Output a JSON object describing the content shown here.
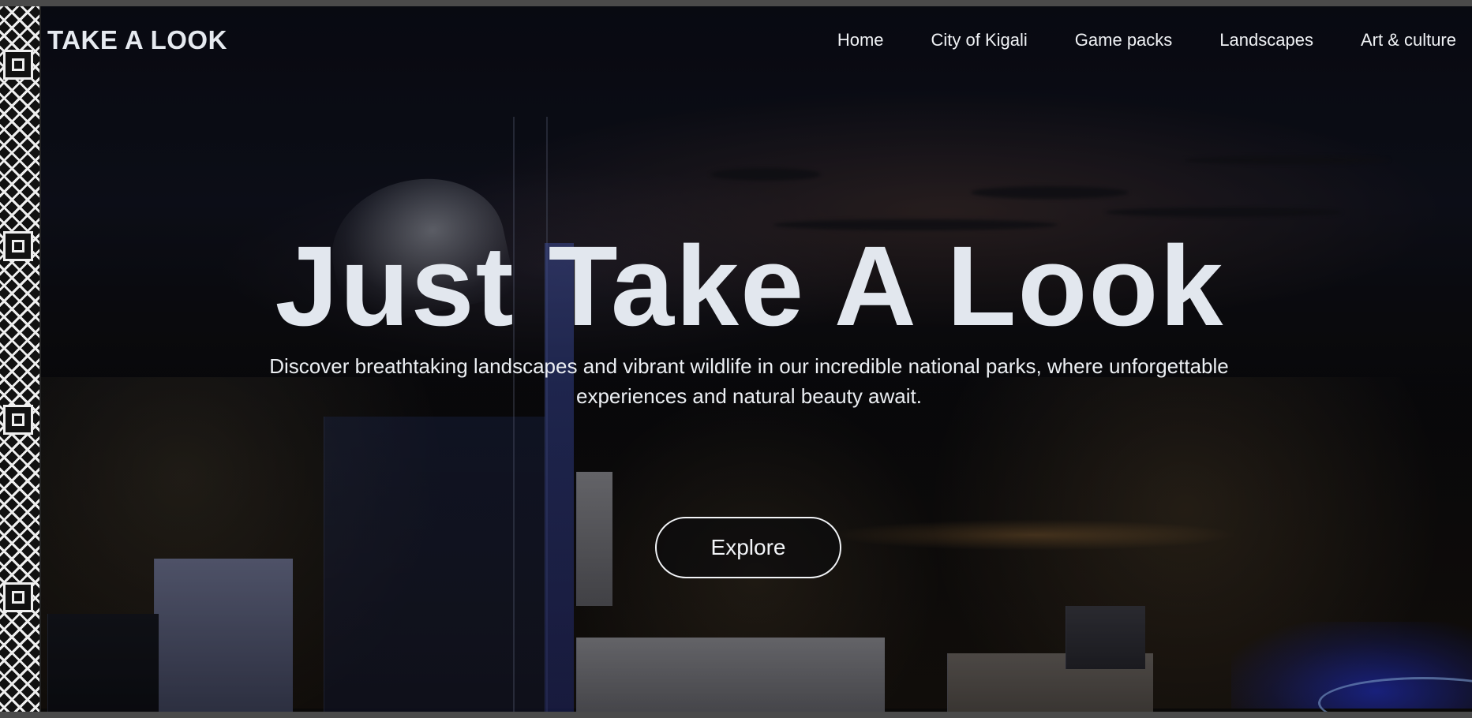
{
  "header": {
    "logo": "TAKE A LOOK"
  },
  "nav": {
    "items": [
      {
        "label": "Home"
      },
      {
        "label": "City of Kigali"
      },
      {
        "label": "Game packs"
      },
      {
        "label": "Landscapes"
      },
      {
        "label": "Art & culture"
      }
    ]
  },
  "hero": {
    "headline": "Just Take A Look",
    "subtitle": "Discover breathtaking landscapes and vibrant wildlife in our incredible national parks, where unforgettable experiences and natural beauty await.",
    "cta_label": "Explore"
  },
  "colors": {
    "text": "#e2e7ee",
    "background": "#0e0e12",
    "accent_blue": "#2a3cff"
  },
  "icons": {
    "side_pattern": "african-geometric-pattern"
  }
}
